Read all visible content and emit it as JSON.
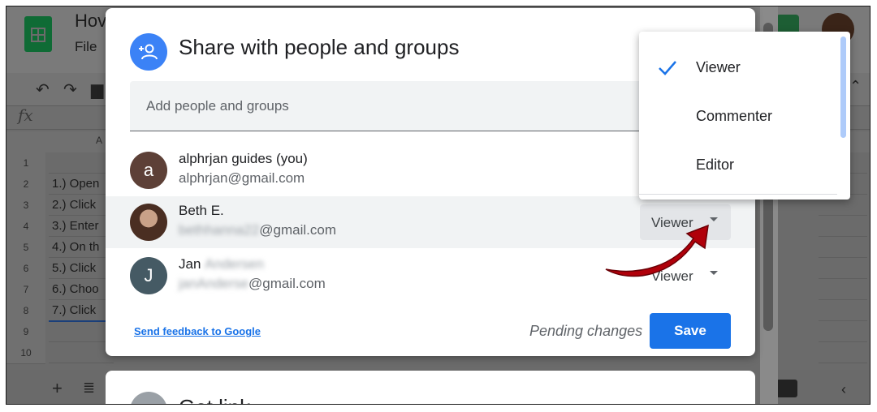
{
  "background": {
    "doc_title": "Hov",
    "menu_file": "File",
    "column_a": "A",
    "rows": [
      {
        "num": "1",
        "text": ""
      },
      {
        "num": "2",
        "text": "1.) Open"
      },
      {
        "num": "3",
        "text": "2.) Click"
      },
      {
        "num": "4",
        "text": "3.) Enter"
      },
      {
        "num": "5",
        "text": "4.) On th"
      },
      {
        "num": "6",
        "text": "5.) Click"
      },
      {
        "num": "7",
        "text": "6.) Choo"
      },
      {
        "num": "8",
        "text": "7.) Click"
      },
      {
        "num": "9",
        "text": ""
      },
      {
        "num": "10",
        "text": ""
      }
    ],
    "fx_label": "fx"
  },
  "dialog": {
    "title": "Share with people and groups",
    "add_placeholder": "Add people and groups",
    "people": [
      {
        "initial": "a",
        "name": "alphrjan guides (you)",
        "email": "alphrjan@gmail.com",
        "role": ""
      },
      {
        "initial": "",
        "name": "Beth E.",
        "email_blurred": "bethhanna22",
        "email_domain": "@gmail.com",
        "role": "Viewer"
      },
      {
        "initial": "J",
        "name": "Jan",
        "name_blurred": "Andersen",
        "email_blurred": "janAnderse",
        "email_domain": "@gmail.com",
        "role": "Viewer"
      }
    ],
    "feedback_link": "Send feedback to Google",
    "pending": "Pending changes",
    "save": "Save"
  },
  "dialog2": {
    "title": "Get link"
  },
  "dropdown": {
    "items": [
      {
        "label": "Viewer",
        "checked": true
      },
      {
        "label": "Commenter",
        "checked": false
      },
      {
        "label": "Editor",
        "checked": false
      }
    ]
  },
  "colors": {
    "accent": "#1a73e8",
    "annotation_arrow": "#c0000a"
  }
}
